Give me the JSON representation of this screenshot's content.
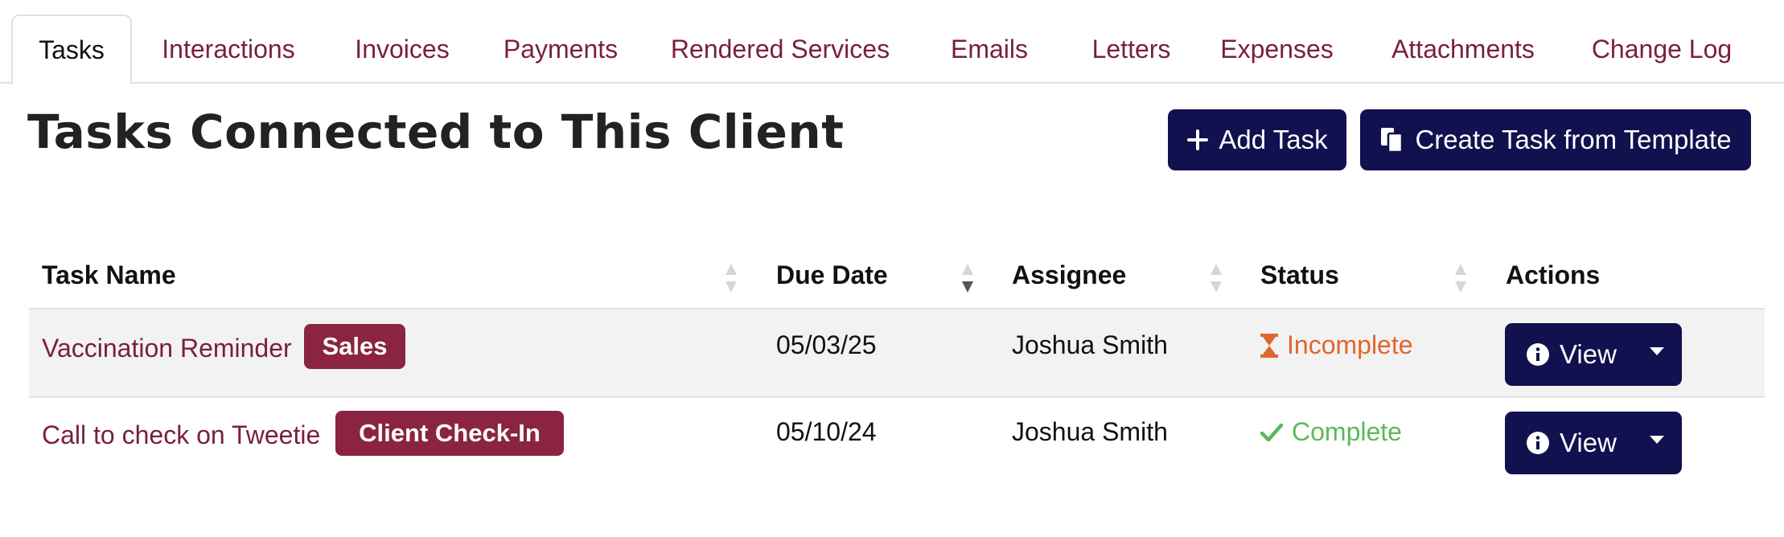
{
  "tabs": [
    {
      "label": "Tasks",
      "active": true
    },
    {
      "label": "Interactions"
    },
    {
      "label": "Invoices"
    },
    {
      "label": "Payments"
    },
    {
      "label": "Rendered Services"
    },
    {
      "label": "Emails"
    },
    {
      "label": "Letters"
    },
    {
      "label": "Expenses"
    },
    {
      "label": "Attachments"
    },
    {
      "label": "Change Log"
    }
  ],
  "header": {
    "title": "Tasks Connected to This Client",
    "add_task_label": "Add Task",
    "add_task_icon": "plus-icon",
    "template_label": "Create Task from Template",
    "template_icon": "copy-icon"
  },
  "table": {
    "columns": [
      "Task Name",
      "Due Date",
      "Assignee",
      "Status",
      "Actions"
    ],
    "sorted_column": "Due Date",
    "rows": [
      {
        "task": "Vaccination Reminder",
        "tag": "Sales",
        "due": "05/03/25",
        "assignee": "Joshua Smith",
        "status": "Incomplete",
        "status_icon": "hourglass-icon",
        "status_color": "#e0662e",
        "action": "View"
      },
      {
        "task": "Call to check on Tweetie",
        "tag": "Client Check-In",
        "due": "05/10/24",
        "assignee": "Joshua Smith",
        "status": "Complete",
        "status_icon": "check-icon",
        "status_color": "#5cb85c",
        "action": "View"
      }
    ]
  },
  "colors": {
    "primary": "#11114f",
    "link": "#7a1f3d",
    "badge": "#8a2441"
  }
}
